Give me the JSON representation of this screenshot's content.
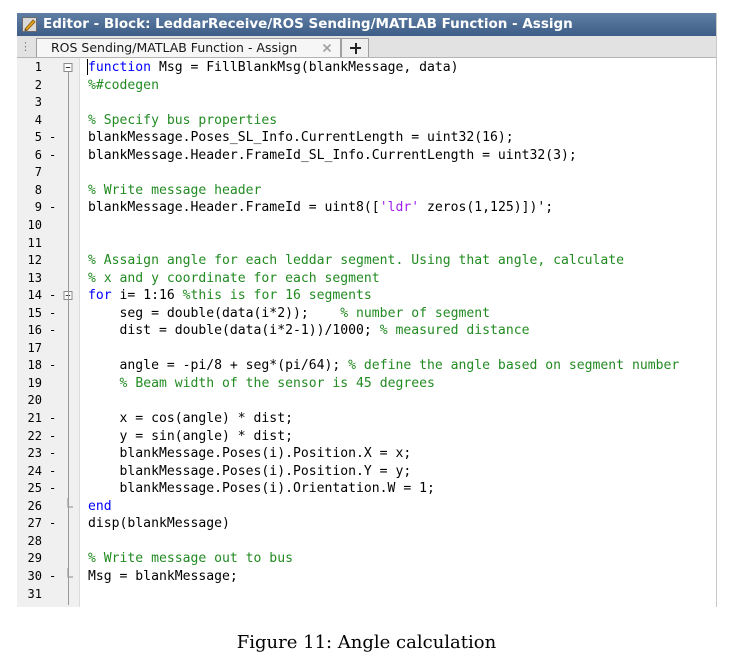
{
  "window": {
    "title": "Editor - Block: LeddarReceive/ROS Sending/MATLAB Function - Assign"
  },
  "tab": {
    "label": "ROS Sending/MATLAB Function - Assign"
  },
  "code_lines": [
    {
      "num": "1",
      "dash": "",
      "parts": [
        {
          "t": "function",
          "c": "kw"
        },
        {
          "t": " Msg = FillBlankMsg(blankMessage, data)",
          "c": ""
        }
      ]
    },
    {
      "num": "2",
      "dash": "",
      "parts": [
        {
          "t": "%#codegen",
          "c": "cm"
        }
      ]
    },
    {
      "num": "3",
      "dash": "",
      "parts": []
    },
    {
      "num": "4",
      "dash": "",
      "parts": [
        {
          "t": "% Specify bus properties",
          "c": "cm"
        }
      ]
    },
    {
      "num": "5",
      "dash": "-",
      "parts": [
        {
          "t": "blankMessage.Poses_SL_Info.CurrentLength = uint32(16);",
          "c": ""
        }
      ]
    },
    {
      "num": "6",
      "dash": "-",
      "parts": [
        {
          "t": "blankMessage.Header.FrameId_SL_Info.CurrentLength = uint32(3);",
          "c": ""
        }
      ]
    },
    {
      "num": "7",
      "dash": "",
      "parts": []
    },
    {
      "num": "8",
      "dash": "",
      "parts": [
        {
          "t": "% Write message header",
          "c": "cm"
        }
      ]
    },
    {
      "num": "9",
      "dash": "-",
      "parts": [
        {
          "t": "blankMessage.Header.FrameId = uint8([",
          "c": ""
        },
        {
          "t": "'ldr'",
          "c": "st"
        },
        {
          "t": " zeros(1,125)])';",
          "c": ""
        }
      ]
    },
    {
      "num": "10",
      "dash": "",
      "parts": []
    },
    {
      "num": "11",
      "dash": "",
      "parts": []
    },
    {
      "num": "12",
      "dash": "",
      "parts": [
        {
          "t": "% Assaign angle for each leddar segment. Using that angle, calculate",
          "c": "cm"
        }
      ]
    },
    {
      "num": "13",
      "dash": "",
      "parts": [
        {
          "t": "% x and y coordinate for each segment",
          "c": "cm"
        }
      ]
    },
    {
      "num": "14",
      "dash": "-",
      "parts": [
        {
          "t": "for",
          "c": "kw"
        },
        {
          "t": " i= 1:16 ",
          "c": ""
        },
        {
          "t": "%this is for 16 segments",
          "c": "cm"
        }
      ]
    },
    {
      "num": "15",
      "dash": "-",
      "parts": [
        {
          "t": "    seg = double(data(i*2));    ",
          "c": ""
        },
        {
          "t": "% number of segment",
          "c": "cm"
        }
      ]
    },
    {
      "num": "16",
      "dash": "-",
      "parts": [
        {
          "t": "    dist = double(data(i*2-1))/1000; ",
          "c": ""
        },
        {
          "t": "% measured distance",
          "c": "cm"
        }
      ]
    },
    {
      "num": "17",
      "dash": "",
      "parts": []
    },
    {
      "num": "18",
      "dash": "-",
      "parts": [
        {
          "t": "    angle = -pi/8 + seg*(pi/64); ",
          "c": ""
        },
        {
          "t": "% define the angle based on segment number",
          "c": "cm"
        }
      ]
    },
    {
      "num": "19",
      "dash": "",
      "parts": [
        {
          "t": "    ",
          "c": ""
        },
        {
          "t": "% Beam width of the sensor is 45 degrees",
          "c": "cm"
        }
      ]
    },
    {
      "num": "20",
      "dash": "",
      "parts": []
    },
    {
      "num": "21",
      "dash": "-",
      "parts": [
        {
          "t": "    x = cos(angle) * dist;",
          "c": ""
        }
      ]
    },
    {
      "num": "22",
      "dash": "-",
      "parts": [
        {
          "t": "    y = sin(angle) * dist;",
          "c": ""
        }
      ]
    },
    {
      "num": "23",
      "dash": "-",
      "parts": [
        {
          "t": "    blankMessage.Poses(i).Position.X = x;",
          "c": ""
        }
      ]
    },
    {
      "num": "24",
      "dash": "-",
      "parts": [
        {
          "t": "    blankMessage.Poses(i).Position.Y = y;",
          "c": ""
        }
      ]
    },
    {
      "num": "25",
      "dash": "-",
      "parts": [
        {
          "t": "    blankMessage.Poses(i).Orientation.W = 1;",
          "c": ""
        }
      ]
    },
    {
      "num": "26",
      "dash": "",
      "parts": [
        {
          "t": "end",
          "c": "kw"
        }
      ]
    },
    {
      "num": "27",
      "dash": "-",
      "parts": [
        {
          "t": "disp(blankMessage)",
          "c": ""
        }
      ]
    },
    {
      "num": "28",
      "dash": "",
      "parts": []
    },
    {
      "num": "29",
      "dash": "",
      "parts": [
        {
          "t": "% Write message out to bus",
          "c": "cm"
        }
      ]
    },
    {
      "num": "30",
      "dash": "-",
      "parts": [
        {
          "t": "Msg = blankMessage;",
          "c": ""
        }
      ]
    },
    {
      "num": "31",
      "dash": "",
      "parts": []
    }
  ],
  "caption": "Figure 11: Angle calculation"
}
